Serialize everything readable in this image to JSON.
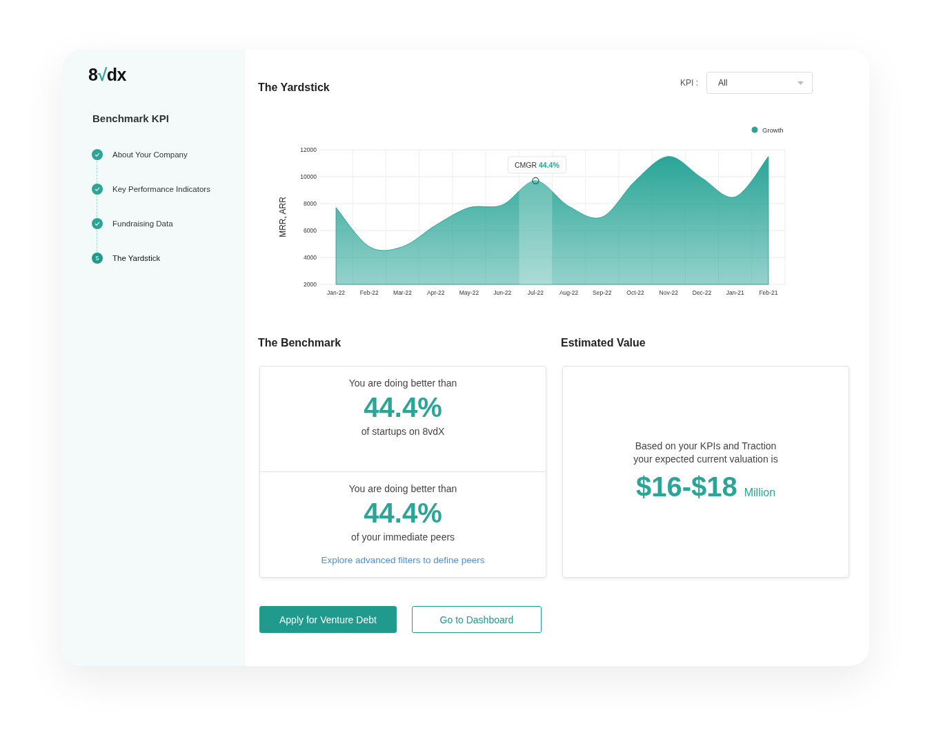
{
  "logo": {
    "prefix": "8",
    "mark": "√",
    "suffix": "dx"
  },
  "sidebar": {
    "title": "Benchmark KPI",
    "steps": [
      {
        "label": "About Your Company",
        "completed": true
      },
      {
        "label": "Key Performance Indicators",
        "completed": true
      },
      {
        "label": "Fundraising Data",
        "completed": true
      },
      {
        "label": "The Yardstick",
        "completed": false,
        "number": "5"
      }
    ]
  },
  "yardstick": {
    "title": "The Yardstick",
    "kpi_label": "KPI :",
    "kpi_value": "All",
    "chart_data": {
      "type": "area",
      "ylabel": "MRR, ARR",
      "categories": [
        "Jan-22",
        "Feb-22",
        "Mar-22",
        "Apr-22",
        "May-22",
        "Jun-22",
        "Jul-22",
        "Aug-22",
        "Sep-22",
        "Oct-22",
        "Nov-22",
        "Dec-22",
        "Jan-21",
        "Feb-21"
      ],
      "series": [
        {
          "name": "Growth",
          "color": "#2aa597",
          "values": [
            7700,
            4800,
            4800,
            6400,
            7700,
            7900,
            9700,
            7800,
            7000,
            9700,
            11500,
            9900,
            8500,
            11500
          ]
        }
      ],
      "ylim": [
        2000,
        12000
      ],
      "yticks": [
        2000,
        4000,
        6000,
        8000,
        10000,
        12000
      ],
      "grid": true
    },
    "tooltip": {
      "label": "CMGR",
      "value": "44.4%"
    },
    "columns": [
      {
        "hovered": false
      },
      {
        "hovered": false
      },
      {
        "hovered": false
      },
      {
        "hovered": false
      },
      {
        "hovered": false
      },
      {
        "hovered": false
      },
      {
        "hovered": true
      },
      {
        "hovered": false
      },
      {
        "hovered": false
      },
      {
        "hovered": false
      },
      {
        "hovered": false
      },
      {
        "hovered": false
      },
      {
        "hovered": false
      },
      {
        "hovered": false
      }
    ]
  },
  "benchmark": {
    "title": "The Benchmark",
    "blocks": [
      {
        "intro": "You are doing better than",
        "value": "44.4%",
        "outro": "of startups on 8vdX"
      },
      {
        "intro": "You are doing better than",
        "value": "44.4%",
        "outro": "of your immediate peers",
        "link": "Explore advanced filters to define peers"
      }
    ]
  },
  "estimate": {
    "title": "Estimated Value",
    "line1": "Based on your KPIs and Traction",
    "line2": "your expected current valuation is",
    "value": "$16-$18",
    "unit": "Million"
  },
  "buttons": [
    {
      "label": "Apply for Venture Debt",
      "kind": "primary"
    },
    {
      "label": "Go to Dashboard",
      "kind": "outline"
    }
  ]
}
